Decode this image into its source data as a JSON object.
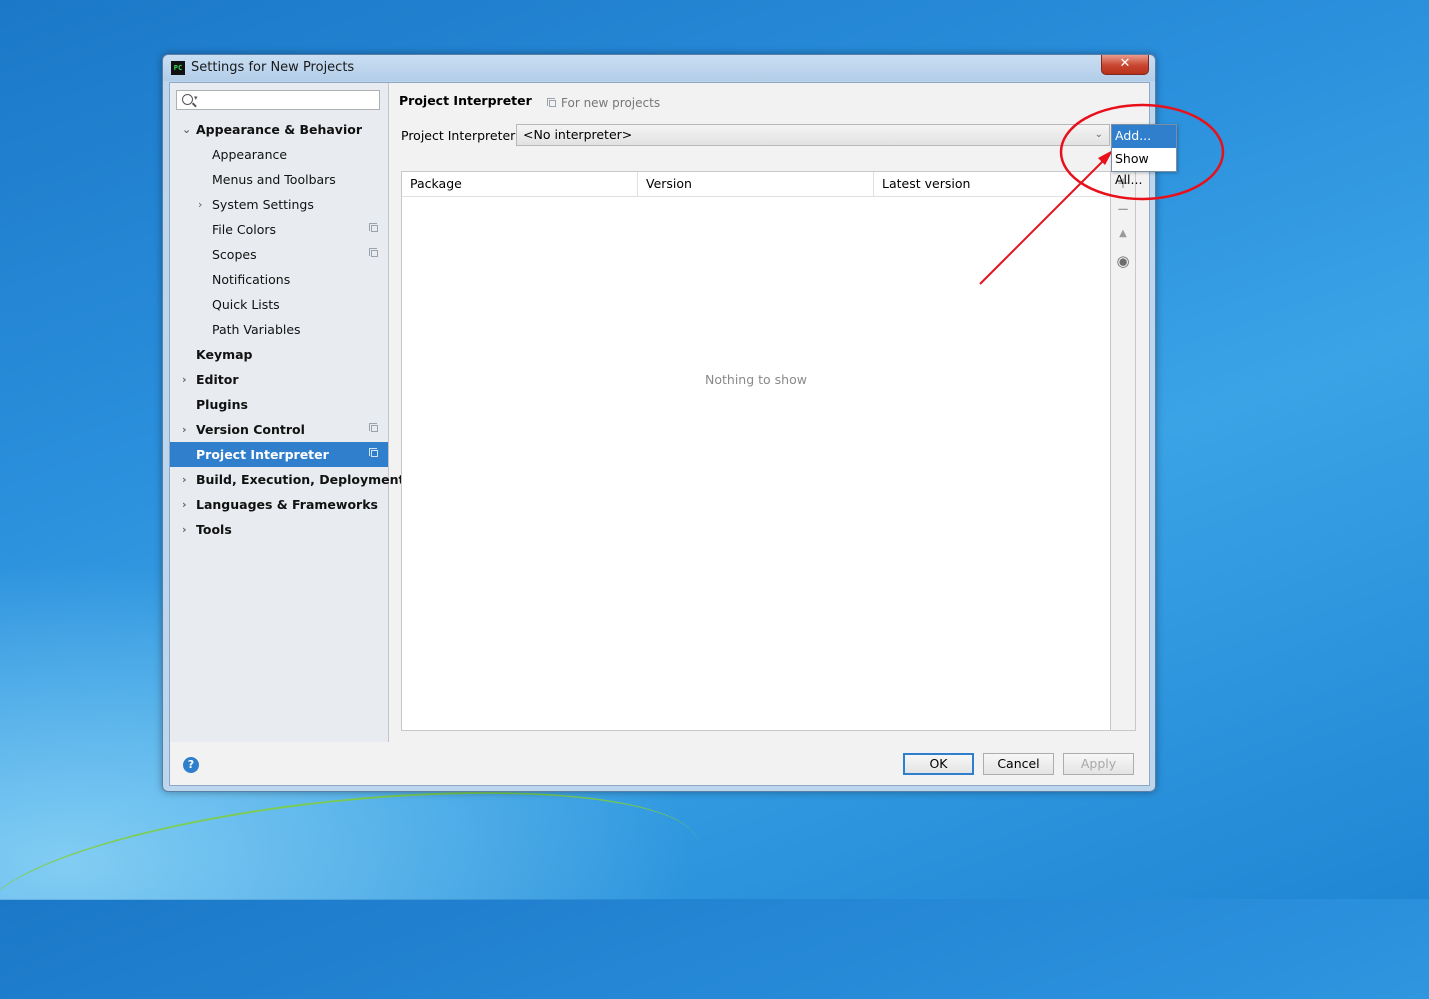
{
  "window": {
    "title": "Settings for New Projects",
    "app_icon_text": "PC",
    "close_symbol": "✕"
  },
  "sidebar": {
    "search": {
      "value": "",
      "placeholder": ""
    },
    "items": [
      {
        "label": "Appearance & Behavior",
        "bold": true,
        "expanded": true
      },
      {
        "label": "Appearance"
      },
      {
        "label": "Menus and Toolbars"
      },
      {
        "label": "System Settings"
      },
      {
        "label": "File Colors"
      },
      {
        "label": "Scopes"
      },
      {
        "label": "Notifications"
      },
      {
        "label": "Quick Lists"
      },
      {
        "label": "Path Variables"
      },
      {
        "label": "Keymap",
        "bold": true
      },
      {
        "label": "Editor",
        "bold": true
      },
      {
        "label": "Plugins",
        "bold": true
      },
      {
        "label": "Version Control",
        "bold": true
      },
      {
        "label": "Project Interpreter",
        "bold": true,
        "selected": true
      },
      {
        "label": "Build, Execution, Deployment",
        "bold": true
      },
      {
        "label": "Languages & Frameworks",
        "bold": true
      },
      {
        "label": "Tools",
        "bold": true
      }
    ]
  },
  "main": {
    "breadcrumb": "Project Interpreter",
    "hint": "For new projects",
    "interpreter_label": "Project Interpreter:",
    "interpreter_value": "<No interpreter>",
    "popup": {
      "add": "Add...",
      "show_all": "Show All..."
    },
    "table": {
      "columns": [
        "Package",
        "Version",
        "Latest version"
      ],
      "empty_text": "Nothing to show"
    }
  },
  "footer": {
    "help": "?",
    "ok": "OK",
    "cancel": "Cancel",
    "apply": "Apply"
  },
  "colors": {
    "selection": "#2f7fcc",
    "annotation": "#e8101a"
  }
}
